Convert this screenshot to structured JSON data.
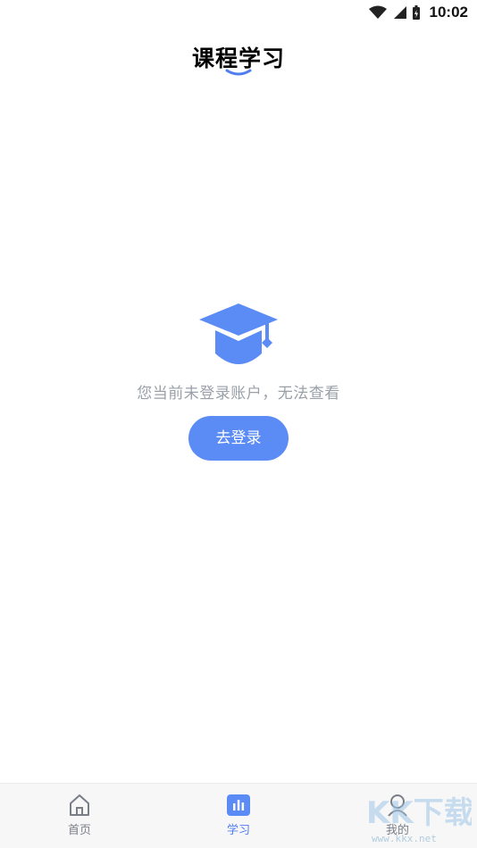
{
  "status_bar": {
    "time": "10:02"
  },
  "header": {
    "title": "课程学习"
  },
  "empty_state": {
    "message": "您当前未登录账户，无法查看",
    "login_button": "去登录"
  },
  "tabbar": {
    "items": [
      {
        "label": "首页",
        "icon": "home-icon",
        "active": false
      },
      {
        "label": "学习",
        "icon": "study-icon",
        "active": true
      },
      {
        "label": "我的",
        "icon": "profile-icon",
        "active": false
      }
    ]
  },
  "watermark": {
    "url": "www.kkx.net",
    "text": "KK下载"
  },
  "colors": {
    "accent": "#5b8bf5",
    "text_muted": "#9aa0a8"
  }
}
